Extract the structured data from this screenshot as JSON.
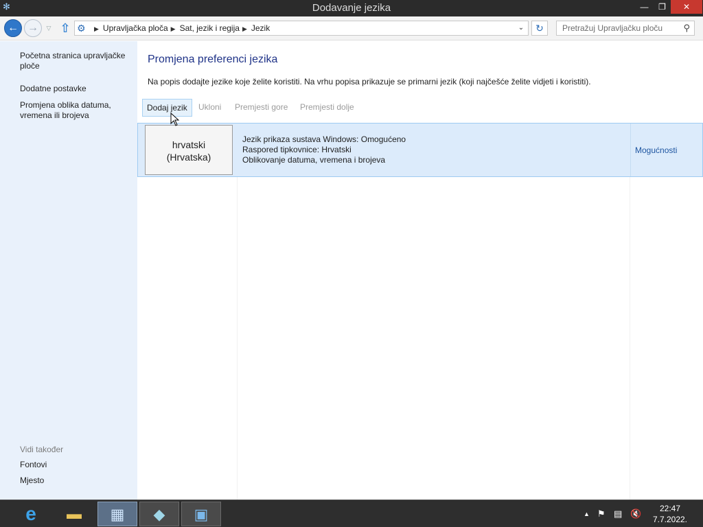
{
  "window": {
    "title": "Dodavanje jezika",
    "minimize_glyph": "—",
    "maximize_glyph": "❐",
    "close_glyph": "✕"
  },
  "navbar": {
    "breadcrumbs": [
      "Upravljačka ploča",
      "Sat, jezik i regija",
      "Jezik"
    ],
    "search_placeholder": "Pretražuj Upravljačku ploču"
  },
  "sidebar": {
    "links": [
      "Početna stranica upravljačke ploče",
      "Dodatne postavke",
      "Promjena oblika datuma, vremena ili brojeva"
    ],
    "see_also_heading": "Vidi također",
    "see_also_links": [
      "Fontovi",
      "Mjesto"
    ]
  },
  "main": {
    "heading": "Promjena preferenci jezika",
    "description": "Na popis dodajte jezike koje želite koristiti. Na vrhu popisa prikazuje se primarni jezik (koji najčešće želite vidjeti i koristiti).",
    "toolbar": {
      "add": "Dodaj jezik",
      "remove": "Ukloni",
      "move_up": "Premjesti gore",
      "move_down": "Premjesti dolje"
    },
    "languages": [
      {
        "name_line1": "hrvatski",
        "name_line2": "(Hrvatska)",
        "details": [
          "Jezik prikaza sustava Windows: Omogućeno",
          "Raspored tipkovnice: Hrvatski",
          "Oblikovanje datuma, vremena i brojeva"
        ],
        "options_label": "Mogućnosti"
      }
    ]
  },
  "taskbar": {
    "items": [
      "internet-explorer-icon",
      "file-explorer-icon",
      "control-panel-icon",
      "notepad-icon",
      "remote-desktop-icon"
    ],
    "clock_time": "22:47",
    "clock_date": "7.7.2022."
  },
  "colors": {
    "titlebar": "#2b2b2b",
    "sidebar_bg": "#e9f1fb",
    "selection_bg": "#dcebfb",
    "link_blue": "#1e55a0",
    "heading_blue": "#1e3287",
    "close_red": "#c7382f"
  }
}
